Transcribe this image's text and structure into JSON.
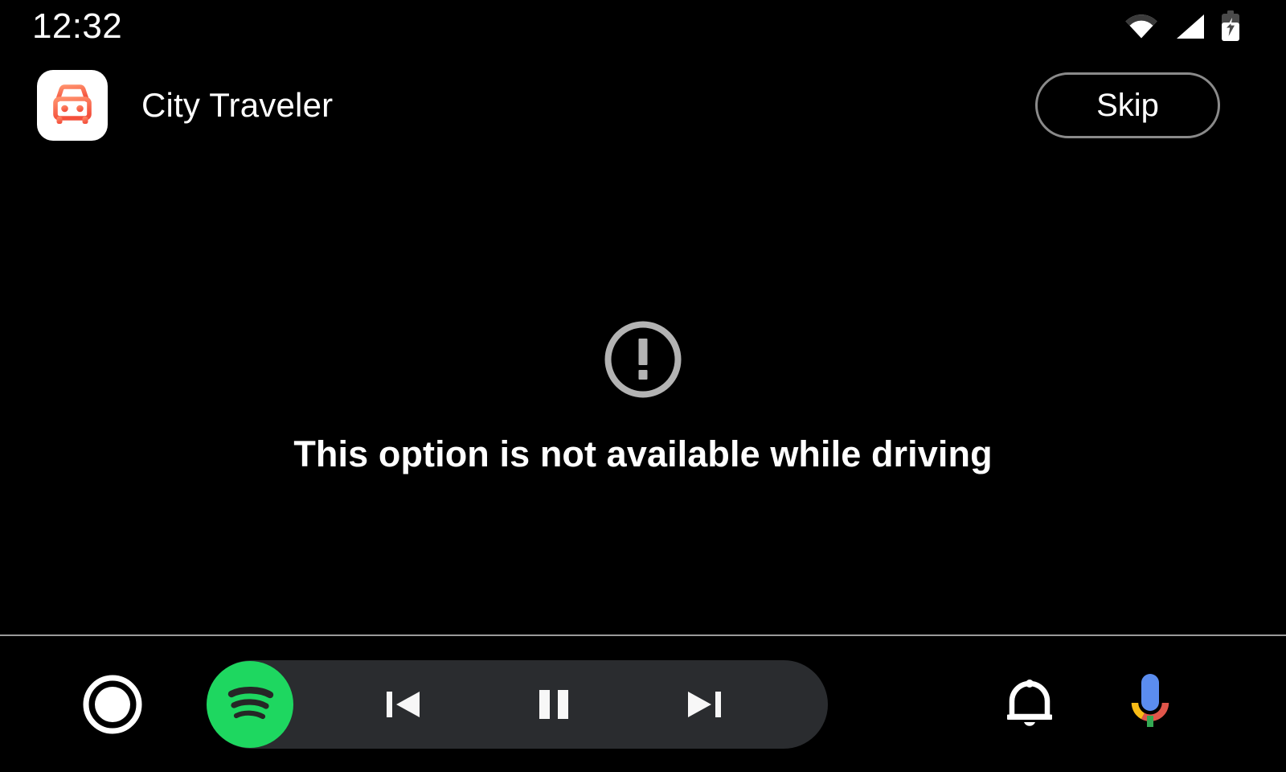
{
  "status_bar": {
    "clock": "12:32",
    "icons": [
      {
        "name": "wifi-icon",
        "label": "Wi-Fi"
      },
      {
        "name": "cell-signal-icon",
        "label": "Cellular signal"
      },
      {
        "name": "battery-charging-icon",
        "label": "Battery charging"
      }
    ]
  },
  "header": {
    "app_icon_name": "car-app-icon",
    "app_title": "City Traveler",
    "skip_label": "Skip"
  },
  "content": {
    "warning_icon_name": "error-circle-icon",
    "message": "This option is not available while driving"
  },
  "bottom_bar": {
    "home_label": "Home",
    "media_app_name": "spotify-logo-icon",
    "previous_label": "Previous track",
    "play_pause_label": "Pause",
    "next_label": "Next track",
    "notifications_label": "Notifications",
    "assistant_label": "Google Assistant"
  },
  "colors": {
    "background": "#000000",
    "text_primary": "#ffffff",
    "icon_muted": "#b3b3b3",
    "divider": "#9a9a9a",
    "media_pill": "#2a2c2f",
    "spotify_green": "#1ed760",
    "app_accent_light": "#ff8a65",
    "app_accent_dark": "#f4503c",
    "google_blue": "#5b8def",
    "google_red": "#e0554a",
    "google_yellow": "#f9bc16",
    "google_green": "#34a853",
    "skip_border": "#8a8a8a"
  }
}
